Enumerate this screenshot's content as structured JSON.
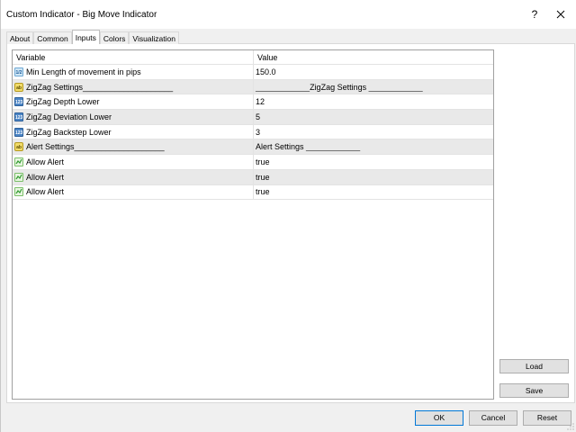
{
  "window": {
    "title": "Custom Indicator - Big Move Indicator",
    "help_label": "?",
    "close_label": "✕"
  },
  "tabs": [
    {
      "label": "About"
    },
    {
      "label": "Common"
    },
    {
      "label": "Inputs"
    },
    {
      "label": "Colors"
    },
    {
      "label": "Visualization"
    }
  ],
  "grid": {
    "header": {
      "variable": "Variable",
      "value": "Value"
    },
    "rows": [
      {
        "icon": "number-icon",
        "variable": "Min Length of movement in pips",
        "value": "150.0"
      },
      {
        "icon": "string-icon",
        "variable": "ZigZag Settings____________________",
        "value": "____________ZigZag Settings ____________"
      },
      {
        "icon": "integer-icon",
        "variable": "ZigZag Depth Lower",
        "value": "12"
      },
      {
        "icon": "integer-icon",
        "variable": "ZigZag Deviation Lower",
        "value": "5"
      },
      {
        "icon": "integer-icon",
        "variable": "ZigZag Backstep Lower",
        "value": "3"
      },
      {
        "icon": "string-icon",
        "variable": "Alert Settings____________________",
        "value": "Alert Settings ____________"
      },
      {
        "icon": "boolean-icon",
        "variable": "Allow Alert",
        "value": "true"
      },
      {
        "icon": "boolean-icon",
        "variable": "Allow Alert",
        "value": "true"
      },
      {
        "icon": "boolean-icon",
        "variable": "Allow Alert",
        "value": "true"
      }
    ]
  },
  "buttons": {
    "load": "Load",
    "save": "Save",
    "ok": "OK",
    "cancel": "Cancel",
    "reset": "Reset"
  },
  "icon_glyphs": {
    "number": "1/2",
    "string": "ab",
    "integer": "123"
  },
  "colors": {
    "accent": "#0078d7",
    "alt_row": "#e9e9e9",
    "chart_green": "#00c000",
    "chart_red": "#e00000"
  }
}
